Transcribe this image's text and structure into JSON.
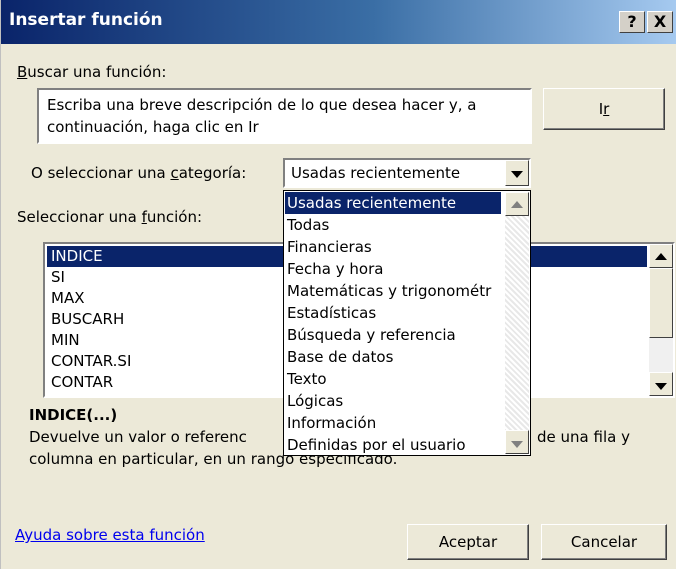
{
  "title": "Insertar función",
  "title_buttons": {
    "help": "?",
    "close": "X"
  },
  "search": {
    "label": "Buscar una función:",
    "placeholder_line1": "Escriba una breve descripción de lo que desea hacer y, a",
    "placeholder_line2": "continuación, haga clic en Ir",
    "go_button": "Ir"
  },
  "category": {
    "label": "O seleccionar una categoría:",
    "selected": "Usadas recientemente",
    "options": [
      "Usadas recientemente",
      "Todas",
      "Financieras",
      "Fecha y hora",
      "Matemáticas y trigonométr",
      "Estadísticas",
      "Búsqueda y referencia",
      "Base de datos",
      "Texto",
      "Lógicas",
      "Información",
      "Definidas por el usuario"
    ]
  },
  "function_list": {
    "label": "Seleccionar una función:",
    "items": [
      "INDICE",
      "SI",
      "MAX",
      "BUSCARH",
      "MIN",
      "CONTAR.SI",
      "CONTAR"
    ],
    "selected": "INDICE"
  },
  "description": {
    "signature": "INDICE(...)",
    "line1_start": "Devuelve un valor o referenc",
    "line1_end": "de una fila y",
    "line2": "columna en particular, en un rango especificado."
  },
  "footer": {
    "help_link": "Ayuda sobre esta función",
    "ok_button": "Aceptar",
    "cancel_button": "Cancelar"
  },
  "colors": {
    "title_bar_start": "#0a246a",
    "selection": "#0a246a",
    "dialog_background": "#ece9d8",
    "link": "#0000ee"
  }
}
